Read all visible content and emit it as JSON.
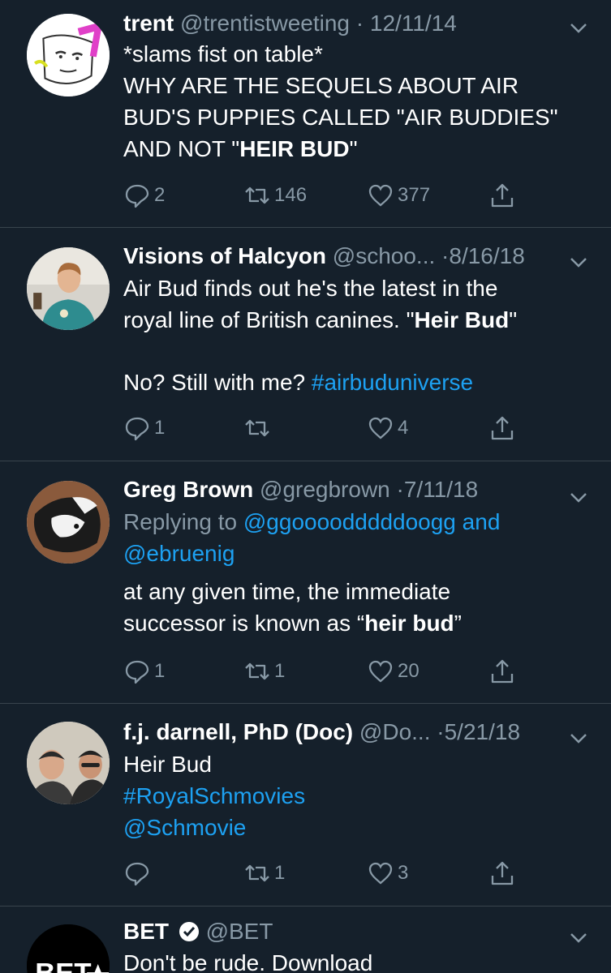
{
  "tweets": [
    {
      "name": "trent",
      "handle": "@trentistweeting",
      "date": "12/11/14",
      "lines": [
        "*slams fist on table*",
        "WHY ARE THE SEQUELS ABOUT AIR",
        "BUD'S PUPPIES CALLED \"AIR BUDDIES\""
      ],
      "line4_pre": "AND NOT \"",
      "line4_bold": "HEIR BUD",
      "line4_post": "\"",
      "replies": "2",
      "retweets": "146",
      "likes": "377"
    },
    {
      "name": "Visions of Halcyon",
      "handle": "@schoo...",
      "date": "8/16/18",
      "line1": "Air Bud finds out he's the latest in the",
      "line2_pre": "royal line of British canines. \"",
      "line2_bold": "Heir Bud",
      "line2_post": "\"",
      "line3_pre": "No? Still with me? ",
      "hashtag": "#airbuduniverse",
      "replies": "1",
      "likes": "4"
    },
    {
      "name": "Greg Brown",
      "handle": "@gregbrown",
      "date": "7/11/18",
      "replying_prefix": "Replying to ",
      "mention1": "@ggoooodddddoogg",
      "and_word": " and",
      "mention2": "@ebruenig",
      "line1": "at any given time, the immediate",
      "line2_pre": "successor is known as “",
      "line2_bold": "heir bud",
      "line2_post": "”",
      "replies": "1",
      "retweets": "1",
      "likes": "20"
    },
    {
      "name": "f.j. darnell, PhD (Doc)",
      "handle": "@Do...",
      "date": "5/21/18",
      "line1": "Heir Bud",
      "hashtag": "#RoyalSchmovies",
      "mention": "@Schmovie",
      "retweets": "1",
      "likes": "3"
    },
    {
      "name": "BET",
      "handle": "@BET",
      "line1": "Don't be rude. Download",
      "avatar_text": "BET"
    }
  ],
  "separator": "·",
  "colors": {
    "background": "#15202b",
    "link": "#1da1f2",
    "muted": "#8899a6",
    "divider": "#38444d"
  }
}
